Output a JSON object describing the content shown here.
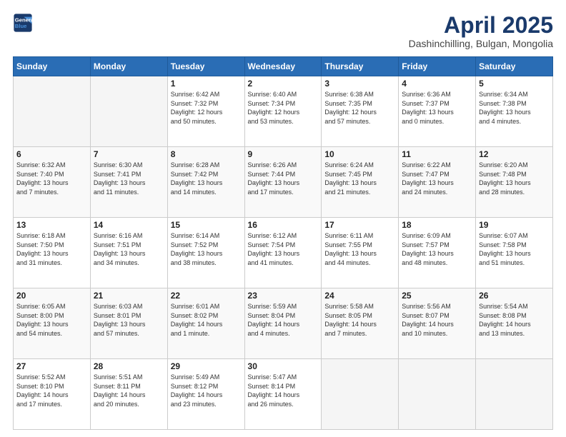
{
  "logo": {
    "line1": "General",
    "line2": "Blue"
  },
  "header": {
    "month": "April 2025",
    "location": "Dashinchilling, Bulgan, Mongolia"
  },
  "weekdays": [
    "Sunday",
    "Monday",
    "Tuesday",
    "Wednesday",
    "Thursday",
    "Friday",
    "Saturday"
  ],
  "weeks": [
    [
      {
        "day": "",
        "info": ""
      },
      {
        "day": "",
        "info": ""
      },
      {
        "day": "1",
        "info": "Sunrise: 6:42 AM\nSunset: 7:32 PM\nDaylight: 12 hours\nand 50 minutes."
      },
      {
        "day": "2",
        "info": "Sunrise: 6:40 AM\nSunset: 7:34 PM\nDaylight: 12 hours\nand 53 minutes."
      },
      {
        "day": "3",
        "info": "Sunrise: 6:38 AM\nSunset: 7:35 PM\nDaylight: 12 hours\nand 57 minutes."
      },
      {
        "day": "4",
        "info": "Sunrise: 6:36 AM\nSunset: 7:37 PM\nDaylight: 13 hours\nand 0 minutes."
      },
      {
        "day": "5",
        "info": "Sunrise: 6:34 AM\nSunset: 7:38 PM\nDaylight: 13 hours\nand 4 minutes."
      }
    ],
    [
      {
        "day": "6",
        "info": "Sunrise: 6:32 AM\nSunset: 7:40 PM\nDaylight: 13 hours\nand 7 minutes."
      },
      {
        "day": "7",
        "info": "Sunrise: 6:30 AM\nSunset: 7:41 PM\nDaylight: 13 hours\nand 11 minutes."
      },
      {
        "day": "8",
        "info": "Sunrise: 6:28 AM\nSunset: 7:42 PM\nDaylight: 13 hours\nand 14 minutes."
      },
      {
        "day": "9",
        "info": "Sunrise: 6:26 AM\nSunset: 7:44 PM\nDaylight: 13 hours\nand 17 minutes."
      },
      {
        "day": "10",
        "info": "Sunrise: 6:24 AM\nSunset: 7:45 PM\nDaylight: 13 hours\nand 21 minutes."
      },
      {
        "day": "11",
        "info": "Sunrise: 6:22 AM\nSunset: 7:47 PM\nDaylight: 13 hours\nand 24 minutes."
      },
      {
        "day": "12",
        "info": "Sunrise: 6:20 AM\nSunset: 7:48 PM\nDaylight: 13 hours\nand 28 minutes."
      }
    ],
    [
      {
        "day": "13",
        "info": "Sunrise: 6:18 AM\nSunset: 7:50 PM\nDaylight: 13 hours\nand 31 minutes."
      },
      {
        "day": "14",
        "info": "Sunrise: 6:16 AM\nSunset: 7:51 PM\nDaylight: 13 hours\nand 34 minutes."
      },
      {
        "day": "15",
        "info": "Sunrise: 6:14 AM\nSunset: 7:52 PM\nDaylight: 13 hours\nand 38 minutes."
      },
      {
        "day": "16",
        "info": "Sunrise: 6:12 AM\nSunset: 7:54 PM\nDaylight: 13 hours\nand 41 minutes."
      },
      {
        "day": "17",
        "info": "Sunrise: 6:11 AM\nSunset: 7:55 PM\nDaylight: 13 hours\nand 44 minutes."
      },
      {
        "day": "18",
        "info": "Sunrise: 6:09 AM\nSunset: 7:57 PM\nDaylight: 13 hours\nand 48 minutes."
      },
      {
        "day": "19",
        "info": "Sunrise: 6:07 AM\nSunset: 7:58 PM\nDaylight: 13 hours\nand 51 minutes."
      }
    ],
    [
      {
        "day": "20",
        "info": "Sunrise: 6:05 AM\nSunset: 8:00 PM\nDaylight: 13 hours\nand 54 minutes."
      },
      {
        "day": "21",
        "info": "Sunrise: 6:03 AM\nSunset: 8:01 PM\nDaylight: 13 hours\nand 57 minutes."
      },
      {
        "day": "22",
        "info": "Sunrise: 6:01 AM\nSunset: 8:02 PM\nDaylight: 14 hours\nand 1 minute."
      },
      {
        "day": "23",
        "info": "Sunrise: 5:59 AM\nSunset: 8:04 PM\nDaylight: 14 hours\nand 4 minutes."
      },
      {
        "day": "24",
        "info": "Sunrise: 5:58 AM\nSunset: 8:05 PM\nDaylight: 14 hours\nand 7 minutes."
      },
      {
        "day": "25",
        "info": "Sunrise: 5:56 AM\nSunset: 8:07 PM\nDaylight: 14 hours\nand 10 minutes."
      },
      {
        "day": "26",
        "info": "Sunrise: 5:54 AM\nSunset: 8:08 PM\nDaylight: 14 hours\nand 13 minutes."
      }
    ],
    [
      {
        "day": "27",
        "info": "Sunrise: 5:52 AM\nSunset: 8:10 PM\nDaylight: 14 hours\nand 17 minutes."
      },
      {
        "day": "28",
        "info": "Sunrise: 5:51 AM\nSunset: 8:11 PM\nDaylight: 14 hours\nand 20 minutes."
      },
      {
        "day": "29",
        "info": "Sunrise: 5:49 AM\nSunset: 8:12 PM\nDaylight: 14 hours\nand 23 minutes."
      },
      {
        "day": "30",
        "info": "Sunrise: 5:47 AM\nSunset: 8:14 PM\nDaylight: 14 hours\nand 26 minutes."
      },
      {
        "day": "",
        "info": ""
      },
      {
        "day": "",
        "info": ""
      },
      {
        "day": "",
        "info": ""
      }
    ]
  ]
}
